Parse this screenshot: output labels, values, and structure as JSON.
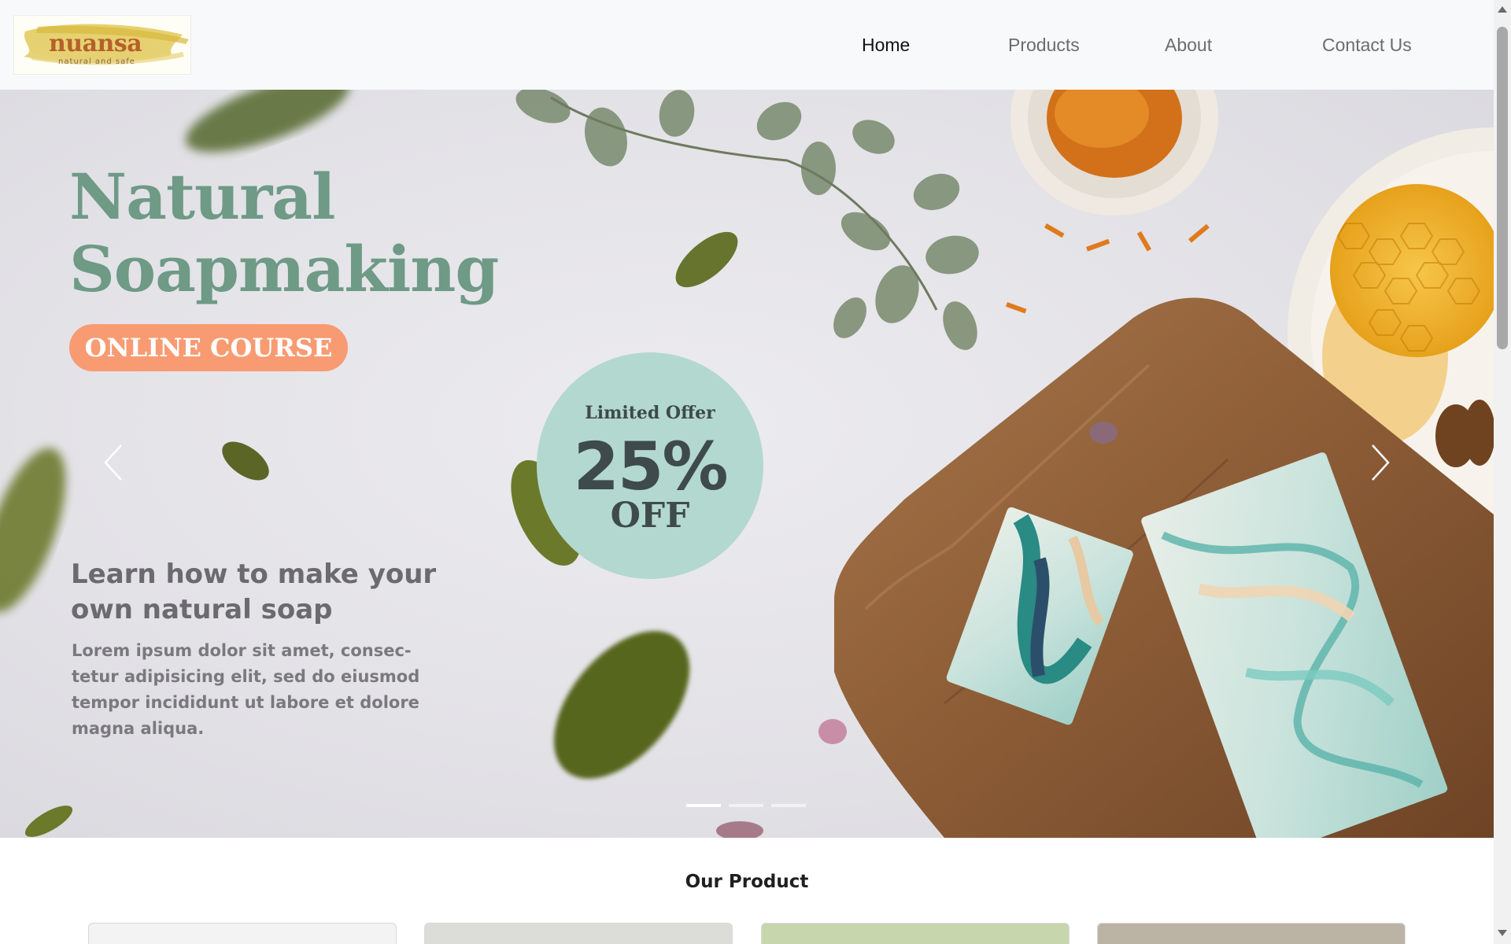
{
  "brand": {
    "name": "nuansa",
    "tagline": "natural and safe"
  },
  "nav": {
    "items": [
      {
        "label": "Home",
        "active": true
      },
      {
        "label": "Products",
        "active": false
      },
      {
        "label": "About",
        "active": false
      },
      {
        "label": "Contact Us",
        "active": false
      }
    ]
  },
  "hero": {
    "title_line1": "Natural",
    "title_line2": "Soapmaking",
    "pill": "ONLINE COURSE",
    "offer": {
      "line1": "Limited Offer",
      "percent": "25%",
      "off": "OFF"
    },
    "subtitle": "Learn how to make your own natural soap",
    "body": "Lorem ipsum dolor sit amet, consec-tetur adipisicing elit, sed do eiusmod tempor incididunt ut labore et dolore magna aliqua.",
    "slides_total": 3,
    "active_slide": 1
  },
  "products": {
    "title": "Our Product",
    "card_colors": [
      "#f3f3f3",
      "#dcdcd8",
      "#c7d6ad",
      "#bbb4a4"
    ]
  },
  "colors": {
    "navbar_bg": "#f8f9fa",
    "title_green": "#6e9a86",
    "pill_orange": "#f89b72",
    "offer_mint": "#b3d8cf"
  },
  "icons": {
    "prev": "chevron-left-icon",
    "next": "chevron-right-icon"
  }
}
